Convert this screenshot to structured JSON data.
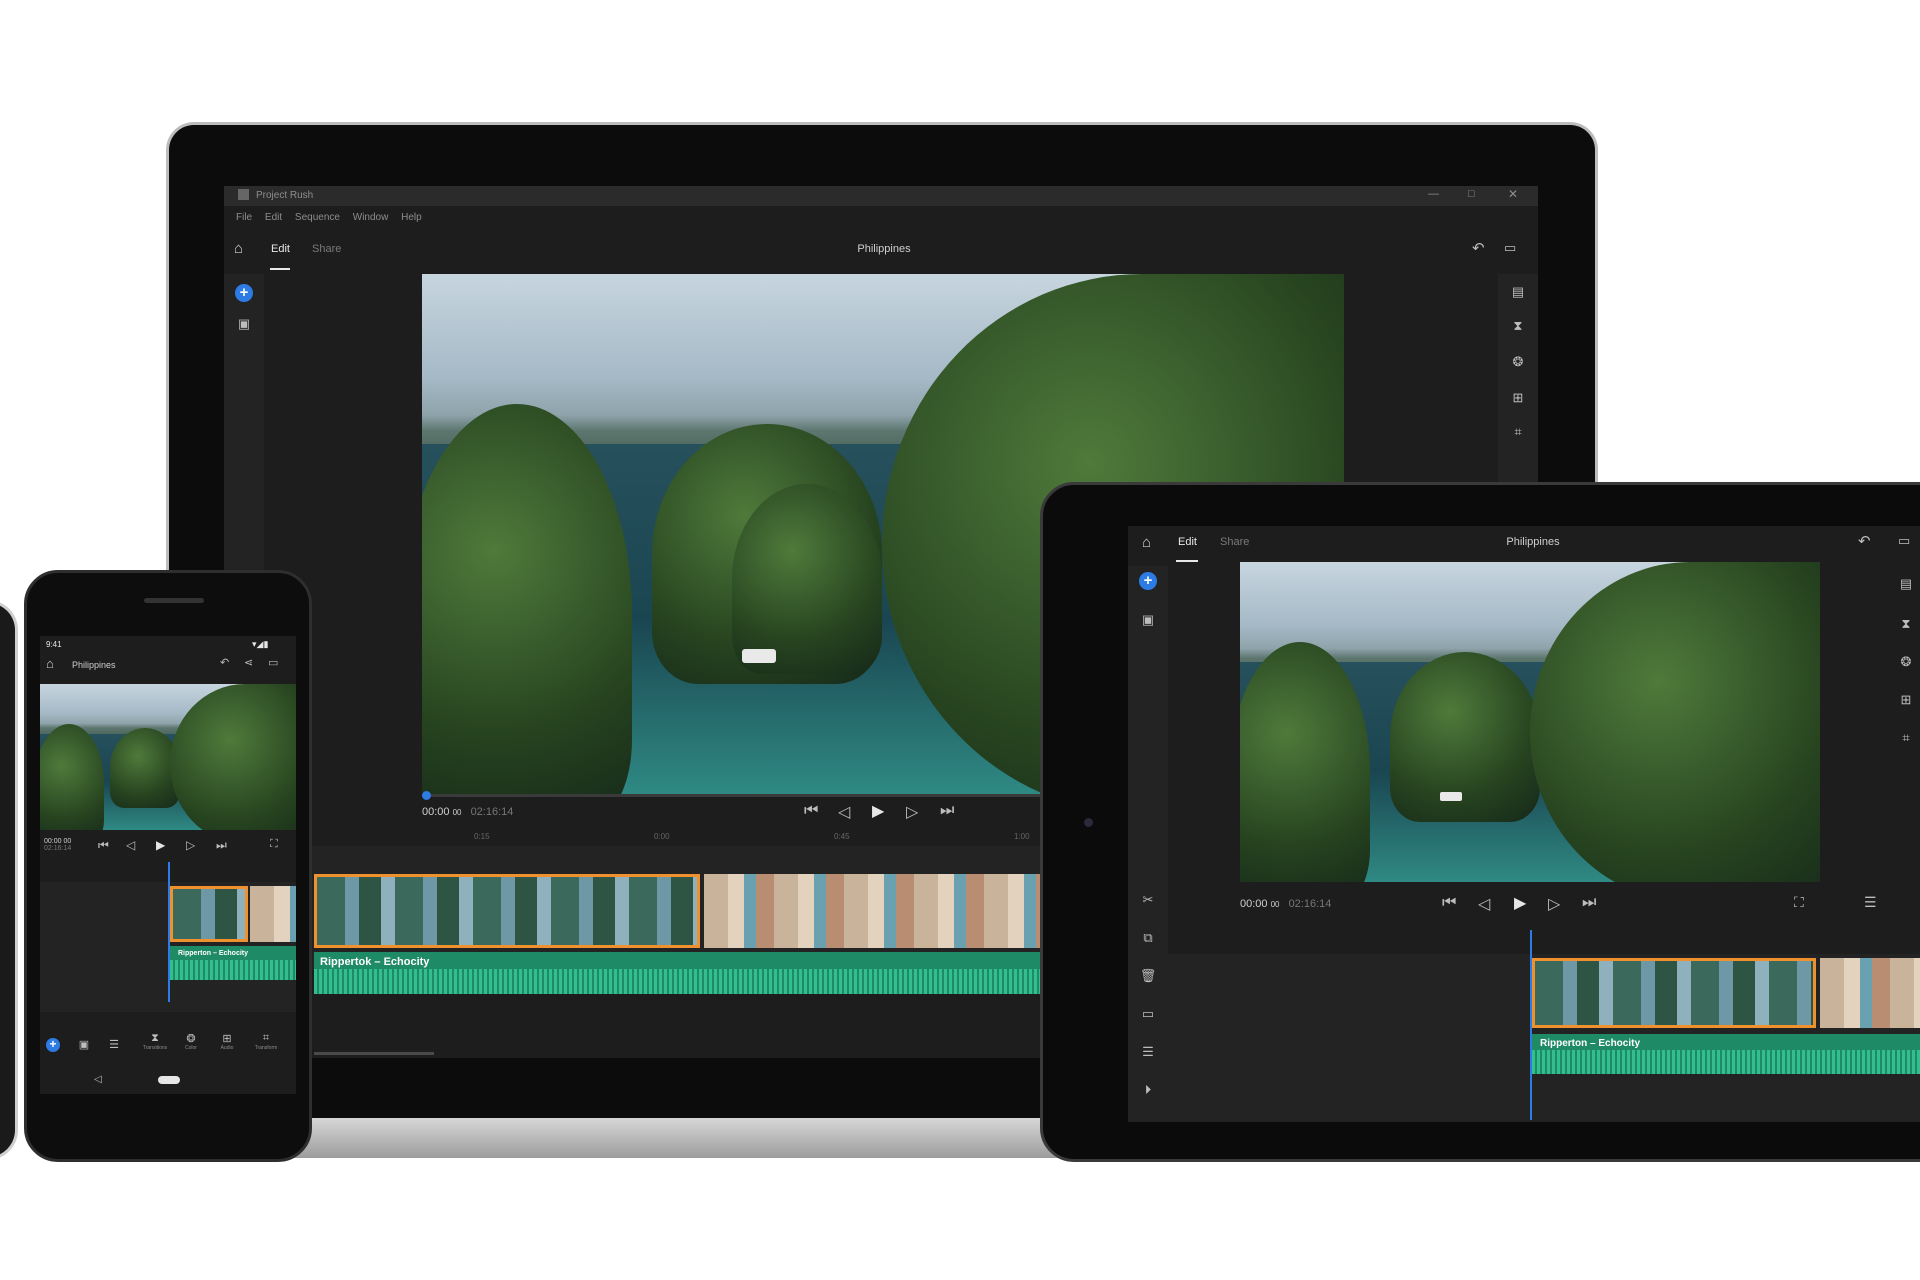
{
  "laptop": {
    "app_title": "Project Rush",
    "menu": [
      "File",
      "Edit",
      "Sequence",
      "Window",
      "Help"
    ],
    "tabs": {
      "edit": "Edit",
      "share": "Share"
    },
    "project_title": "Philippines",
    "timecode_current": "00:00",
    "timecode_current_frames": "00",
    "timecode_total": "02:16:14",
    "ruler": [
      "0:15",
      "0:00",
      "0:45",
      "1:00"
    ],
    "audio_track_label": "Rippertok – Echocity"
  },
  "tablet": {
    "tabs": {
      "edit": "Edit",
      "share": "Share"
    },
    "project_title": "Philippines",
    "timecode_current": "00:00",
    "timecode_current_frames": "00",
    "timecode_total": "02:16:14",
    "audio_track_label": "Ripperton – Echocity"
  },
  "phone": {
    "status_time": "9:41",
    "project_title": "Philippines",
    "timecode_current": "00:00",
    "timecode_current_frames": "00",
    "timecode_total": "02:16:14",
    "audio_track_label": "Ripperton – Echocity",
    "bottom_tools": [
      "Transitions",
      "Color",
      "Audio",
      "Transform"
    ]
  },
  "colors": {
    "accent": "#2d7be5",
    "clip_selected": "#f0912f",
    "audio": "#1f8a66"
  }
}
